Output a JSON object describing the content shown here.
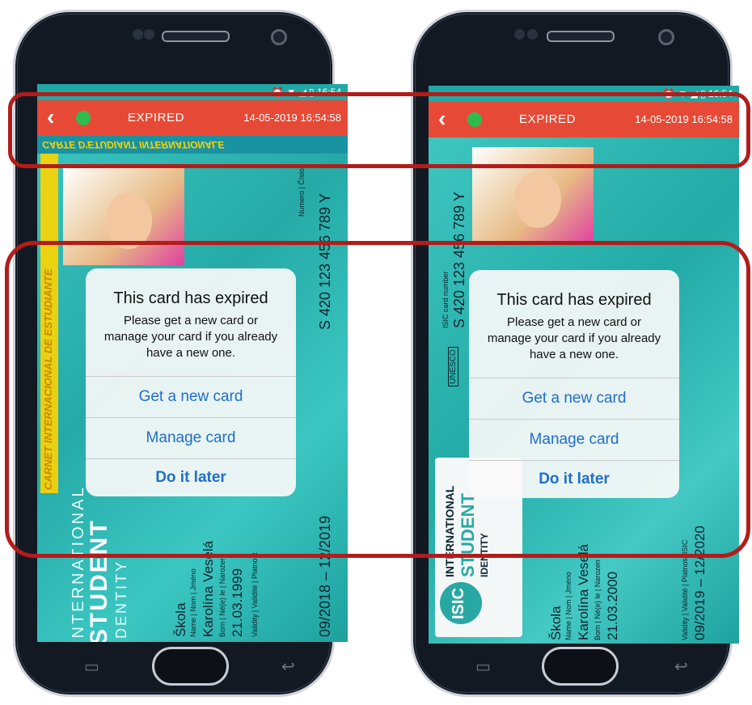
{
  "colors": {
    "accent_red": "#e64a36",
    "online_dot": "#2ebd4d",
    "dialog_button": "#1f6fc9",
    "highlight_border": "#b41c1a"
  },
  "left": {
    "status": {
      "time": "16:54"
    },
    "appbar": {
      "back_icon": "chevron-left-icon",
      "status": "EXPIRED",
      "timestamp": "14-05-2019 16:54:58"
    },
    "card": {
      "top_band": "CARTE D'ETUDIANT INTERNATIONALE",
      "side_band": "CARNET INTERNACIONAL DE ESTUDIANTE",
      "number_label": "Numero | Číslo",
      "number": "S 420 123 456 789 Y",
      "brand_lines": [
        "INTERNATIONAL",
        "STUDENT",
        "IDENTITY"
      ],
      "school": "Škola",
      "name_label": "Name | Nom | Jméno",
      "name": "Karolína Veselá",
      "born_label": "Born | Né(e) le | Narozen",
      "born": "21.03.1999",
      "validity_label": "Validity | Validité | Platnost",
      "validity": "09/2018 – 12/2019"
    },
    "dialog": {
      "title": "This card has expired",
      "message": "Please get a new card or manage your card if you already have a new one.",
      "btn_new": "Get a new card",
      "btn_manage": "Manage card",
      "btn_later": "Do it later"
    }
  },
  "right": {
    "status": {
      "time": "16:54"
    },
    "appbar": {
      "back_icon": "chevron-left-icon",
      "status": "EXPIRED",
      "timestamp": "14-05-2019 16:54:58"
    },
    "card": {
      "number_label": "ISIC card number",
      "number": "S 420 123 456 789 Y",
      "unesco": "UNESCO",
      "brand_lines": [
        "INTERNATIONAL",
        "STUDENT",
        "IDENTITY"
      ],
      "logo": "ISIC",
      "school": "Škola",
      "name_label": "Name | Nom | Jméno",
      "name": "Karolína Veselá",
      "born_label": "Born | Né(e) le | Narozen",
      "born": "21.03.2000",
      "validity_label": "Validity | Validité | Platnost ISIC",
      "validity": "09/2019 – 12/2020"
    },
    "dialog": {
      "title": "This card has expired",
      "message": "Please get a new card or manage your card if you already have a new one.",
      "btn_new": "Get a new card",
      "btn_manage": "Manage card",
      "btn_later": "Do it later"
    }
  }
}
